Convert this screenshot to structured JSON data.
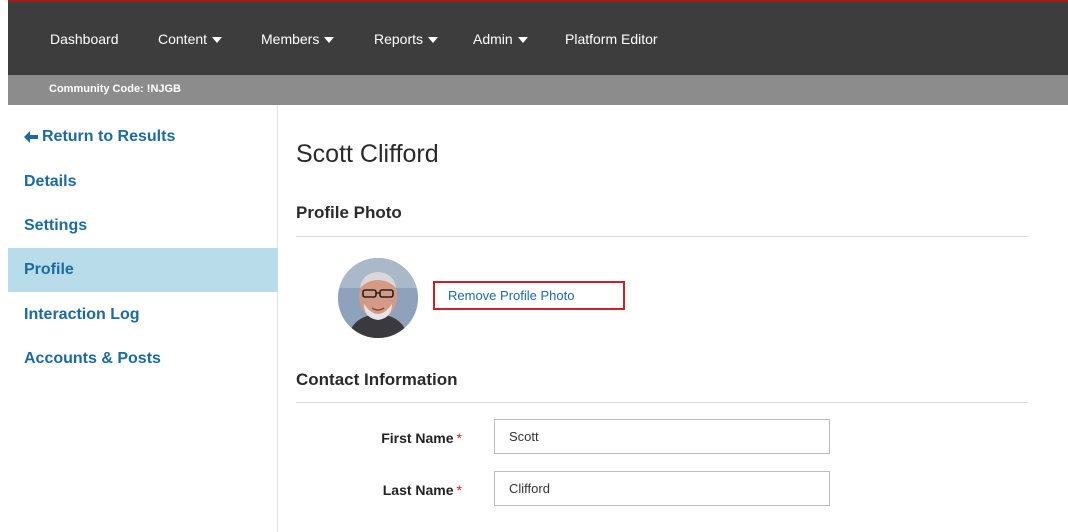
{
  "topnav": {
    "items": [
      {
        "label": "Dashboard",
        "dropdown": false
      },
      {
        "label": "Content",
        "dropdown": true
      },
      {
        "label": "Members",
        "dropdown": true
      },
      {
        "label": "Reports",
        "dropdown": true
      },
      {
        "label": "Admin",
        "dropdown": true
      },
      {
        "label": "Platform Editor",
        "dropdown": false
      }
    ],
    "accent_color": "#a11b1b"
  },
  "subbar": {
    "community_code": "Community Code: !NJGB"
  },
  "sidebar": {
    "items": [
      {
        "label": "Return to Results",
        "icon": "arrow-left-icon"
      },
      {
        "label": "Details"
      },
      {
        "label": "Settings"
      },
      {
        "label": "Profile",
        "active": true
      },
      {
        "label": "Interaction Log"
      },
      {
        "label": "Accounts & Posts"
      }
    ],
    "link_color": "#1d6aa3",
    "active_bg": "#b9dceb"
  },
  "main": {
    "title": "Scott Clifford",
    "profile_photo": {
      "heading": "Profile Photo",
      "remove_label": "Remove Profile Photo",
      "remove_border_color": "#c5232b"
    },
    "contact": {
      "heading": "Contact Information",
      "required_marker": "*",
      "fields": [
        {
          "label": "First Name",
          "value": "Scott"
        },
        {
          "label": "Last Name",
          "value": "Clifford"
        }
      ]
    }
  }
}
